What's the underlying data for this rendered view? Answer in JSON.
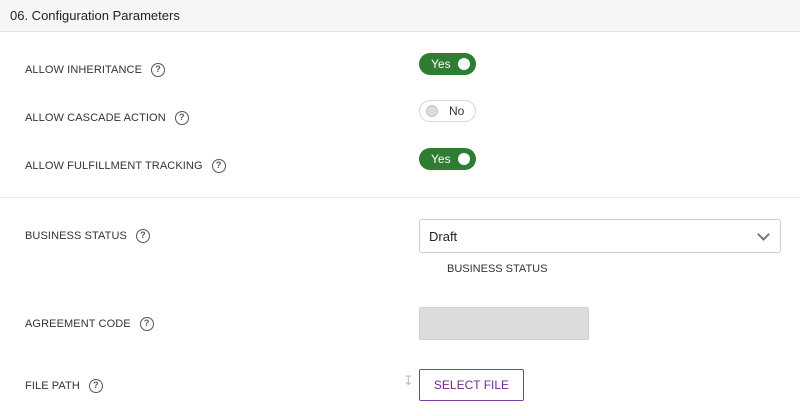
{
  "section": {
    "title": "06. Configuration Parameters"
  },
  "fields": {
    "allow_inheritance": {
      "label": "ALLOW INHERITANCE",
      "value": "Yes"
    },
    "allow_cascade_action": {
      "label": "ALLOW CASCADE ACTION",
      "value": "No"
    },
    "allow_fulfillment_tracking": {
      "label": "ALLOW FULFILLMENT TRACKING",
      "value": "Yes"
    },
    "business_status": {
      "label": "BUSINESS STATUS",
      "value": "Draft",
      "helper": "BUSINESS STATUS"
    },
    "agreement_code": {
      "label": "AGREEMENT CODE",
      "value": ""
    },
    "file_path": {
      "label": "FILE PATH",
      "button_label": "SELECT FILE"
    }
  },
  "icons": {
    "help": "?"
  },
  "colors": {
    "toggle_on": "#2e7d32",
    "accent": "#6a2c91"
  }
}
